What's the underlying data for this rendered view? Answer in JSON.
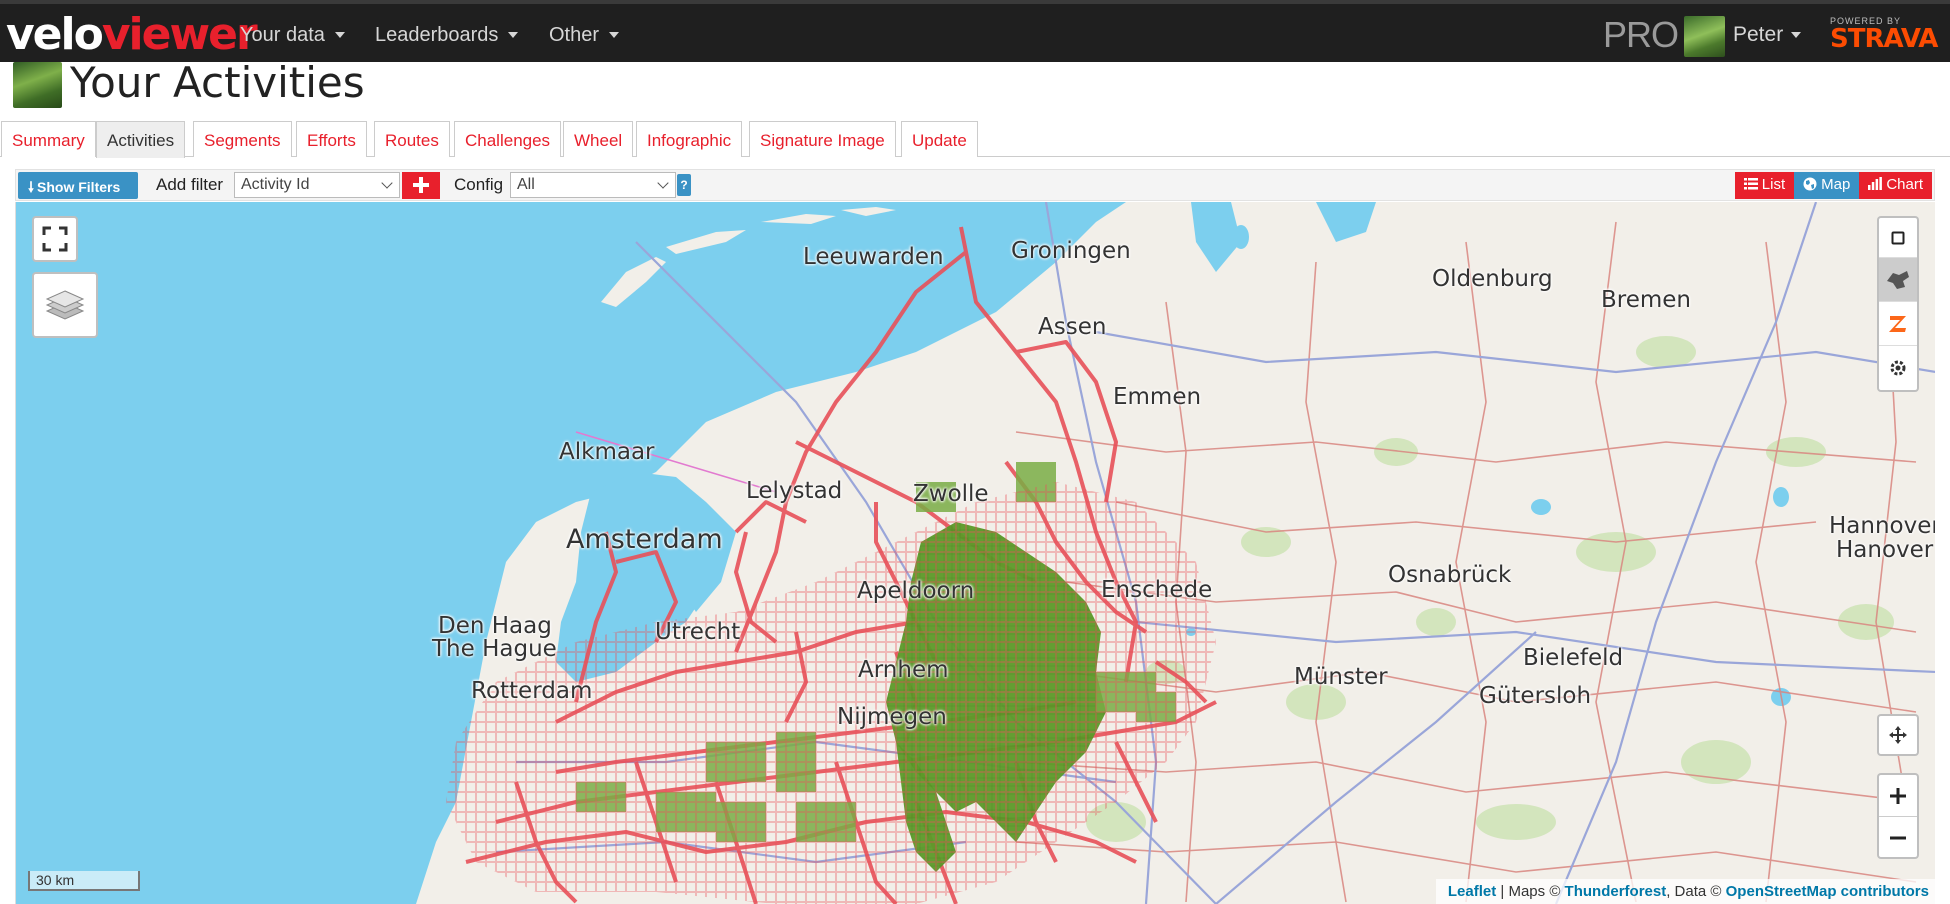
{
  "navbar": {
    "logo_part1": "velo",
    "logo_part2": "viewer",
    "menu": [
      "Your data",
      "Leaderboards",
      "Other"
    ],
    "pro_label": "PRO",
    "user_name": "Peter",
    "powered_by": "POWERED BY",
    "strava_label": "STRAVA"
  },
  "page": {
    "title": "Your Activities"
  },
  "tabs": [
    "Summary",
    "Activities",
    "Segments",
    "Efforts",
    "Routes",
    "Challenges",
    "Wheel",
    "Infographic",
    "Signature Image",
    "Update"
  ],
  "active_tab": "Activities",
  "toolbar": {
    "show_filters_label": "Show Filters",
    "add_filter_label": "Add filter",
    "filter_select_value": "Activity Id",
    "config_label": "Config",
    "config_select_value": "All",
    "help_label": "?",
    "view_list_label": "List",
    "view_map_label": "Map",
    "view_chart_label": "Chart",
    "active_view": "Map"
  },
  "map": {
    "cities": {
      "leeuwarden": "Leeuwarden",
      "groningen": "Groningen",
      "oldenburg": "Oldenburg",
      "bremen": "Bremen",
      "assen": "Assen",
      "emmen": "Emmen",
      "alkmaar": "Alkmaar",
      "lelystad": "Lelystad",
      "zwolle": "Zwolle",
      "amsterdam": "Amsterdam",
      "hannover1": "Hannover",
      "hannover2": "Hanover",
      "osnabruck": "Osnabrück",
      "apeldoorn": "Apeldoorn",
      "enschede": "Enschede",
      "den_haag": "Den Haag",
      "the_hague": "The Hague",
      "utrecht": "Utrecht",
      "bielefeld": "Bielefeld",
      "arnhem": "Arnhem",
      "munster": "Münster",
      "rotterdam": "Rotterdam",
      "gutersloh": "Gütersloh",
      "nijmegen": "Nijmegen"
    },
    "scale_label": "30 km",
    "attribution": {
      "leaflet": "Leaflet",
      "maps_prefix": " | Maps © ",
      "thunderforest": "Thunderforest",
      "data_prefix": ", Data © ",
      "osm": "OpenStreetMap contributors"
    },
    "colors": {
      "water": "#7ccfee",
      "land": "#f2efe9",
      "tile_outline": "#e8515a",
      "cluster_fill": "#5c9a28",
      "road": "#d98680",
      "motorway": "#9aa6d9",
      "accent": "#e8202c",
      "button_blue": "#3a92c5"
    }
  }
}
